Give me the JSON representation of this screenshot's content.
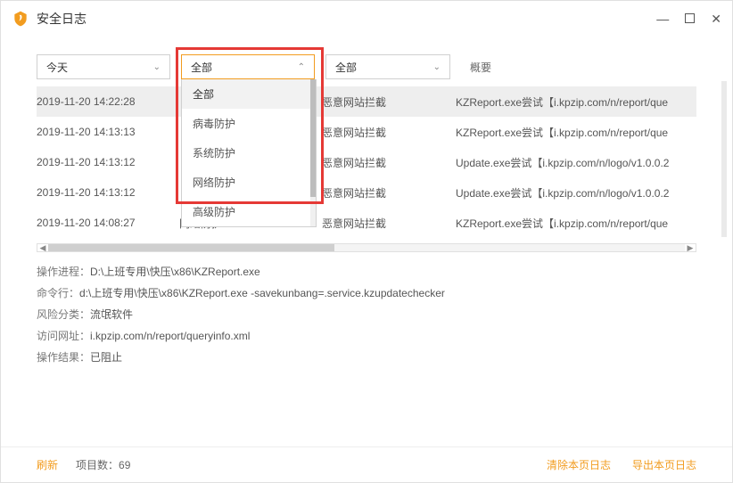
{
  "window": {
    "title": "安全日志"
  },
  "filters": {
    "date_label": "今天",
    "module_label": "全部",
    "type_label": "全部",
    "summary_label": "概要"
  },
  "dropdown": {
    "items": [
      {
        "label": "全部"
      },
      {
        "label": "病毒防护"
      },
      {
        "label": "系统防护"
      },
      {
        "label": "网络防护"
      },
      {
        "label": "高级防护"
      }
    ]
  },
  "rows": [
    {
      "time": "2019-11-20 14:22:28",
      "module": "",
      "type": "恶意网站拦截",
      "summary": "KZReport.exe尝试【i.kpzip.com/n/report/que"
    },
    {
      "time": "2019-11-20 14:13:13",
      "module": "",
      "type": "恶意网站拦截",
      "summary": "KZReport.exe尝试【i.kpzip.com/n/report/que"
    },
    {
      "time": "2019-11-20 14:13:12",
      "module": "",
      "type": "恶意网站拦截",
      "summary": "Update.exe尝试【i.kpzip.com/n/logo/v1.0.0.2"
    },
    {
      "time": "2019-11-20 14:13:12",
      "module": "",
      "type": "恶意网站拦截",
      "summary": "Update.exe尝试【i.kpzip.com/n/logo/v1.0.0.2"
    },
    {
      "time": "2019-11-20 14:08:27",
      "module": "网络防护",
      "type": "恶意网站拦截",
      "summary": "KZReport.exe尝试【i.kpzip.com/n/report/que"
    }
  ],
  "details": {
    "k_proc": "操作进程：",
    "v_proc": "D:\\上班专用\\快压\\x86\\KZReport.exe",
    "k_cmd": "命令行：",
    "v_cmd": "d:\\上班专用\\快压\\x86\\KZReport.exe -savekunbang=.service.kzupdatechecker",
    "k_risk": "风险分类：",
    "v_risk": "流氓软件",
    "k_url": "访问网址：",
    "v_url": "i.kpzip.com/n/report/queryinfo.xml",
    "k_res": "操作结果：",
    "v_res": "已阻止"
  },
  "footer": {
    "refresh": "刷新",
    "count": "项目数：69",
    "clear": "清除本页日志",
    "export": "导出本页日志"
  }
}
